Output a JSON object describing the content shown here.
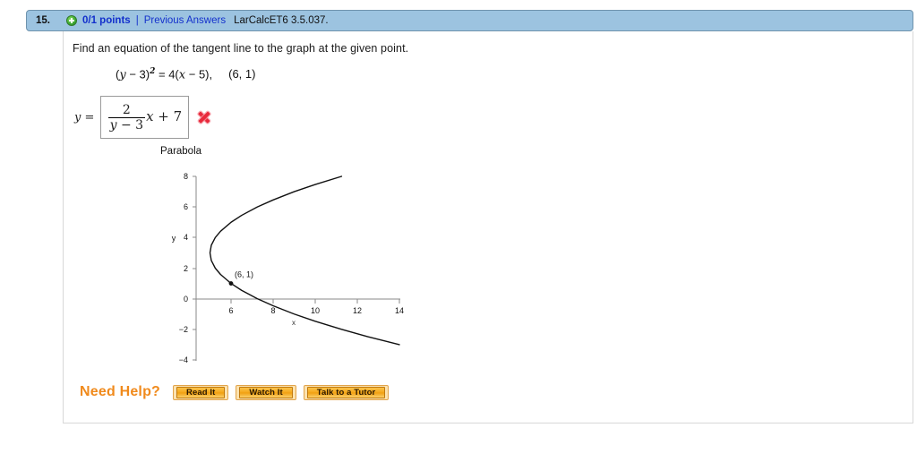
{
  "header": {
    "question_number": "15.",
    "status_icon": "plus-circle-icon",
    "points": "0/1 points",
    "separator": "|",
    "previous_answers": "Previous Answers",
    "assignment_code": "LarCalcET6 3.5.037.",
    "bar_color": "#9cc3e0",
    "link_color": "#1330cc"
  },
  "question": {
    "prompt": "Find an equation of the tangent line to the graph at the given point.",
    "given_equation": {
      "lhs_open": "(",
      "lhs_var": "y",
      "lhs_minus": " − ",
      "lhs_const": "3",
      "lhs_close": ")",
      "exponent": "2",
      "equals": " = ",
      "rhs": "4(",
      "rhs_var": "x",
      "rhs_minus": " − ",
      "rhs_const": "5",
      "rhs_close": "),",
      "point": "(6, 1)"
    },
    "answer": {
      "label_var": "y",
      "label_equals": " =",
      "numerator": "2",
      "denominator_var": "y",
      "denominator_op": " − ",
      "denominator_const": "3",
      "tail_var": "x",
      "tail_op": " + ",
      "tail_const": "7",
      "result_icon": "red-x-incorrect-icon",
      "result_color": "#e8293b",
      "is_correct": false
    }
  },
  "chart_data": {
    "type": "line",
    "title": "Parabola",
    "xlabel": "x",
    "ylabel": "y",
    "xlim": [
      4,
      14.6
    ],
    "ylim": [
      -4,
      8
    ],
    "xticks": [
      6,
      8,
      10,
      12,
      14
    ],
    "yticks": [
      8,
      6,
      4,
      2,
      0,
      -2,
      -4
    ],
    "xtick_labels": [
      "6",
      "8",
      "10",
      "12",
      "14"
    ],
    "ytick_labels": [
      "8",
      "6",
      "4",
      "2",
      "0",
      "−2",
      "−4"
    ],
    "grid": false,
    "legend": null,
    "curve_equation": "(y - 3)^2 = 4(x - 5)",
    "curve_description": "Rightward-opening parabola with vertex at (5, 3)",
    "series": [
      {
        "name": "parabola",
        "color": "#111111",
        "x": [
          11.25,
          10.0,
          9.0,
          8.0,
          7.25,
          6.5,
          6.0,
          5.5,
          5.25,
          5.0625,
          5.0,
          5.0625,
          5.25,
          5.5,
          6.0,
          6.5,
          7.25,
          8.0,
          9.0,
          10.0,
          11.25,
          12.5,
          14.0
        ],
        "y": [
          8.0,
          7.47,
          7.0,
          6.46,
          6.0,
          5.45,
          5.0,
          4.41,
          4.0,
          3.5,
          3.0,
          2.5,
          2.0,
          1.59,
          1.0,
          0.55,
          0.0,
          -0.46,
          -1.0,
          -1.47,
          -2.0,
          -2.48,
          -3.0
        ]
      }
    ],
    "annotations": [
      {
        "label": "(6, 1)",
        "x": 6,
        "y": 1,
        "marker": "filled-dot"
      }
    ]
  },
  "need_help": {
    "label": "Need Help?",
    "label_color": "#f08a1c",
    "buttons": [
      {
        "label": "Read It"
      },
      {
        "label": "Watch It"
      },
      {
        "label": "Talk to a Tutor"
      }
    ]
  }
}
